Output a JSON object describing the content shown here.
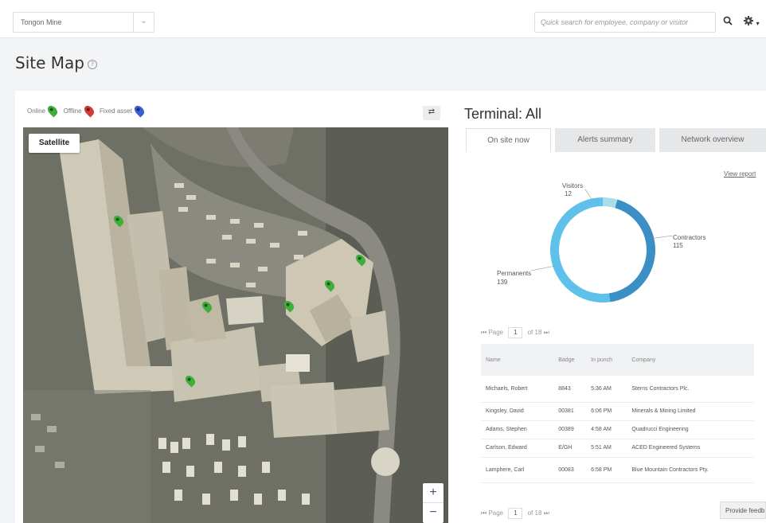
{
  "topbar": {
    "site_selector_value": "Tongon Mine",
    "search_placeholder": "Quick search for employee, company or visitor",
    "search_icon": "search-icon",
    "settings_icon": "gear-icon"
  },
  "page": {
    "title": "Site Map",
    "help_icon": "question-circle-icon"
  },
  "map": {
    "legend": {
      "online": "Online",
      "offline": "Offline",
      "fixed_asset": "Fixed asset"
    },
    "legend_colors": {
      "online": "#3fae3a",
      "offline": "#d23b3b",
      "fixed_asset": "#3a5fd0"
    },
    "expand_icon": "expand-icon",
    "satellite_label": "Satellite",
    "zoom_in": "+",
    "zoom_out": "−",
    "markers": [
      "online",
      "online",
      "online",
      "online",
      "online",
      "online"
    ]
  },
  "terminal": {
    "title": "Terminal: All",
    "tabs": [
      {
        "label": "On site now",
        "active": true
      },
      {
        "label": "Alerts summary",
        "active": false
      },
      {
        "label": "Network overview",
        "active": false
      }
    ],
    "view_report": "View report",
    "feedback": "Provide feedb"
  },
  "chart_data": {
    "type": "pie",
    "categories": [
      "Visitors",
      "Contractors",
      "Permanents"
    ],
    "values": [
      12,
      115,
      139
    ],
    "colors": [
      "#a8ddea",
      "#3a8fc4",
      "#5fc0ea"
    ],
    "title": ""
  },
  "chart_labels": {
    "visitors": "Visitors",
    "visitors_value": "12",
    "contractors": "Contractors",
    "contractors_value": "115",
    "permanents": "Permanents",
    "permanents_value": "139"
  },
  "pager": {
    "page_label": "Page",
    "page_value": "1",
    "of_label": "of 18"
  },
  "table": {
    "headers": [
      "Name",
      "Badge",
      "In punch",
      "Company"
    ],
    "rows": [
      [
        "Michaels, Robert",
        "8843",
        "5:36 AM",
        "Sterns Contractors Plc."
      ],
      [
        "Kingsley, David",
        "00381",
        "6:06 PM",
        "Minerals & Mining Limited"
      ],
      [
        "Adams, Stephen",
        "00389",
        "4:58 AM",
        "Quadrucci Engineering"
      ],
      [
        "Carlson, Edward",
        "E/GH",
        "5:51 AM",
        "ACED Engineered Systems"
      ],
      [
        "Lamphere, Carl",
        "00083",
        "6:58 PM",
        "Blue Mountain Contractors Pty."
      ]
    ]
  }
}
